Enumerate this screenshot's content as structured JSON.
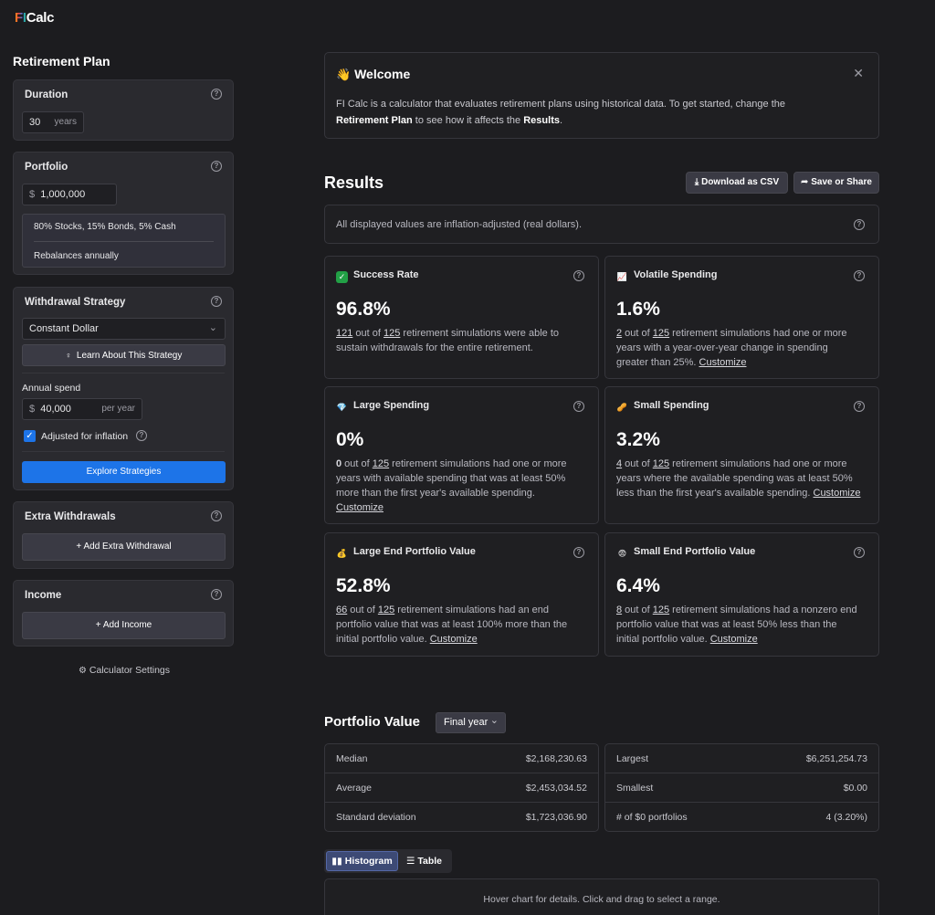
{
  "app": {
    "logo_fi": "FI",
    "logo_calc": "Calc"
  },
  "sidebar": {
    "title": "Retirement Plan",
    "duration": {
      "title": "Duration",
      "value": "30",
      "unit": "years"
    },
    "portfolio": {
      "title": "Portfolio",
      "currency": "$",
      "value": "1,000,000",
      "allocation": "80% Stocks, 15% Bonds, 5% Cash",
      "rebalance": "Rebalances annually"
    },
    "withdrawal": {
      "title": "Withdrawal Strategy",
      "strategy": "Constant Dollar",
      "learn_label": "Learn About This Strategy",
      "annual_label": "Annual spend",
      "currency": "$",
      "annual_value": "40,000",
      "annual_unit": "per year",
      "inflation_label": "Adjusted for inflation",
      "inflation_checked": true,
      "explore_label": "Explore Strategies"
    },
    "extra": {
      "title": "Extra Withdrawals",
      "add_label": "+ Add Extra Withdrawal"
    },
    "income": {
      "title": "Income",
      "add_label": "+ Add Income"
    },
    "settings_label": "Calculator Settings"
  },
  "welcome": {
    "title": "Welcome",
    "text_1": "FI Calc is a calculator that evaluates retirement plans using historical data. To get started, change the",
    "text_bold_1": "Retirement Plan",
    "text_2": " to see how it affects the ",
    "text_bold_2": "Results",
    "text_3": "."
  },
  "results": {
    "title": "Results",
    "download_label": "Download as CSV",
    "share_label": "Save or Share",
    "note": "All displayed values are inflation-adjusted (real dollars).",
    "cards": [
      {
        "title": "Success Rate",
        "icon": "check-icon",
        "value": "96.8%",
        "n": "121",
        "out_of": " out of ",
        "total": "125",
        "line1": " retirement simulations were able to",
        "line2": "sustain withdrawals for the entire retirement.",
        "line3": "",
        "line4": ""
      },
      {
        "title": "Volatile Spending",
        "icon": "chart-icon",
        "value": "1.6%",
        "n": "2",
        "out_of": " out of ",
        "total": "125",
        "line1": " retirement simulations had one or more",
        "line2": "years with a year-over-year change in spending",
        "line3": "greater than 25%. ",
        "customize": "Customize"
      },
      {
        "title": "Large Spending",
        "icon": "diamond-icon",
        "value": "0%",
        "n": "0",
        "out_of": " out of ",
        "total": "125",
        "line1": " retirement simulations had one or more",
        "line2": "years with available spending that was at least 50%",
        "line3": "more than the first year's available spending.",
        "customize": "Customize"
      },
      {
        "title": "Small Spending",
        "icon": "peanut-icon",
        "value": "3.2%",
        "n": "4",
        "out_of": " out of ",
        "total": "125",
        "line1": " retirement simulations had one or more",
        "line2": "years where the available spending was at least 50%",
        "line3": "less than the first year's available spending. ",
        "customize": "Customize"
      },
      {
        "title": "Large End Portfolio Value",
        "icon": "money-bag-icon",
        "value": "52.8%",
        "n": "66",
        "out_of": " out of ",
        "total": "125",
        "line1": " retirement simulations had an end",
        "line2": "portfolio value that was at least 100% more than the",
        "line3": "initial portfolio value. ",
        "customize": "Customize"
      },
      {
        "title": "Small End Portfolio Value",
        "icon": "fearful-face-icon",
        "value": "6.4%",
        "n": "8",
        "out_of": " out of ",
        "total": "125",
        "line1": " retirement simulations had a nonzero end",
        "line2": "portfolio value that was at least 50% less than the",
        "line3": "initial portfolio value. ",
        "customize": "Customize"
      }
    ]
  },
  "portfolio_value": {
    "title": "Portfolio Value",
    "select": "Final year",
    "left": [
      {
        "label": "Median",
        "value": "$2,168,230.63"
      },
      {
        "label": "Average",
        "value": "$2,453,034.52"
      },
      {
        "label": "Standard deviation",
        "value": "$1,723,036.90"
      }
    ],
    "right": [
      {
        "label": "Largest",
        "value": "$6,251,254.73"
      },
      {
        "label": "Smallest",
        "value": "$0.00"
      },
      {
        "label": "# of $0 portfolios",
        "value": "4 (3.20%)"
      }
    ],
    "tabs": [
      "Histogram",
      "Table"
    ],
    "hint": "Hover chart for details. Click and drag to select a range."
  }
}
